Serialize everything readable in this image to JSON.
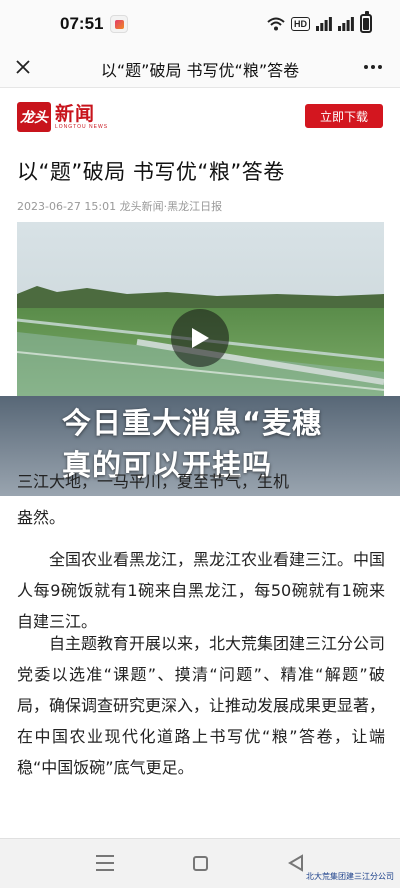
{
  "status_bar": {
    "time": "07:51",
    "network": "HD"
  },
  "title_bar": {
    "title": "以“题”破局 书写优“粮”答卷"
  },
  "news_header": {
    "logo_mark": "龙头",
    "logo_cn": "新闻",
    "logo_en": "LONGTOU NEWS",
    "download_label": "立即下载"
  },
  "article": {
    "title": "以“题”破局 书写优“粮”答卷",
    "meta": "2023-06-27 15:01 龙头新闻·黑龙江日报",
    "overlay_text": "今日重大消息“麦穗真的可以开挂吗",
    "fragment_line1": "三江大地，一马平川，夏至节气，生机",
    "fragment_line2": "盎然。",
    "paragraph_1": "全国农业看黑龙江，黑龙江农业看建三江。中国人每9碗饭就有1碗来自黑龙江，每50碗就有1碗来自建三江。",
    "paragraph_2": "自主题教育开展以来，北大荒集团建三江分公司党委以选准“课题”、摸清“问题”、精准“解题”破局，确保调查研究更深入，让推动发展成果更显著，在中国农业现代化道路上书写优“粮”答卷，让端稳“中国饭碗”底气更足。"
  },
  "watermark": "北大荒集团建三江分公司",
  "colors": {
    "brand_red": "#d3161f",
    "overlay": "#3c5064"
  }
}
